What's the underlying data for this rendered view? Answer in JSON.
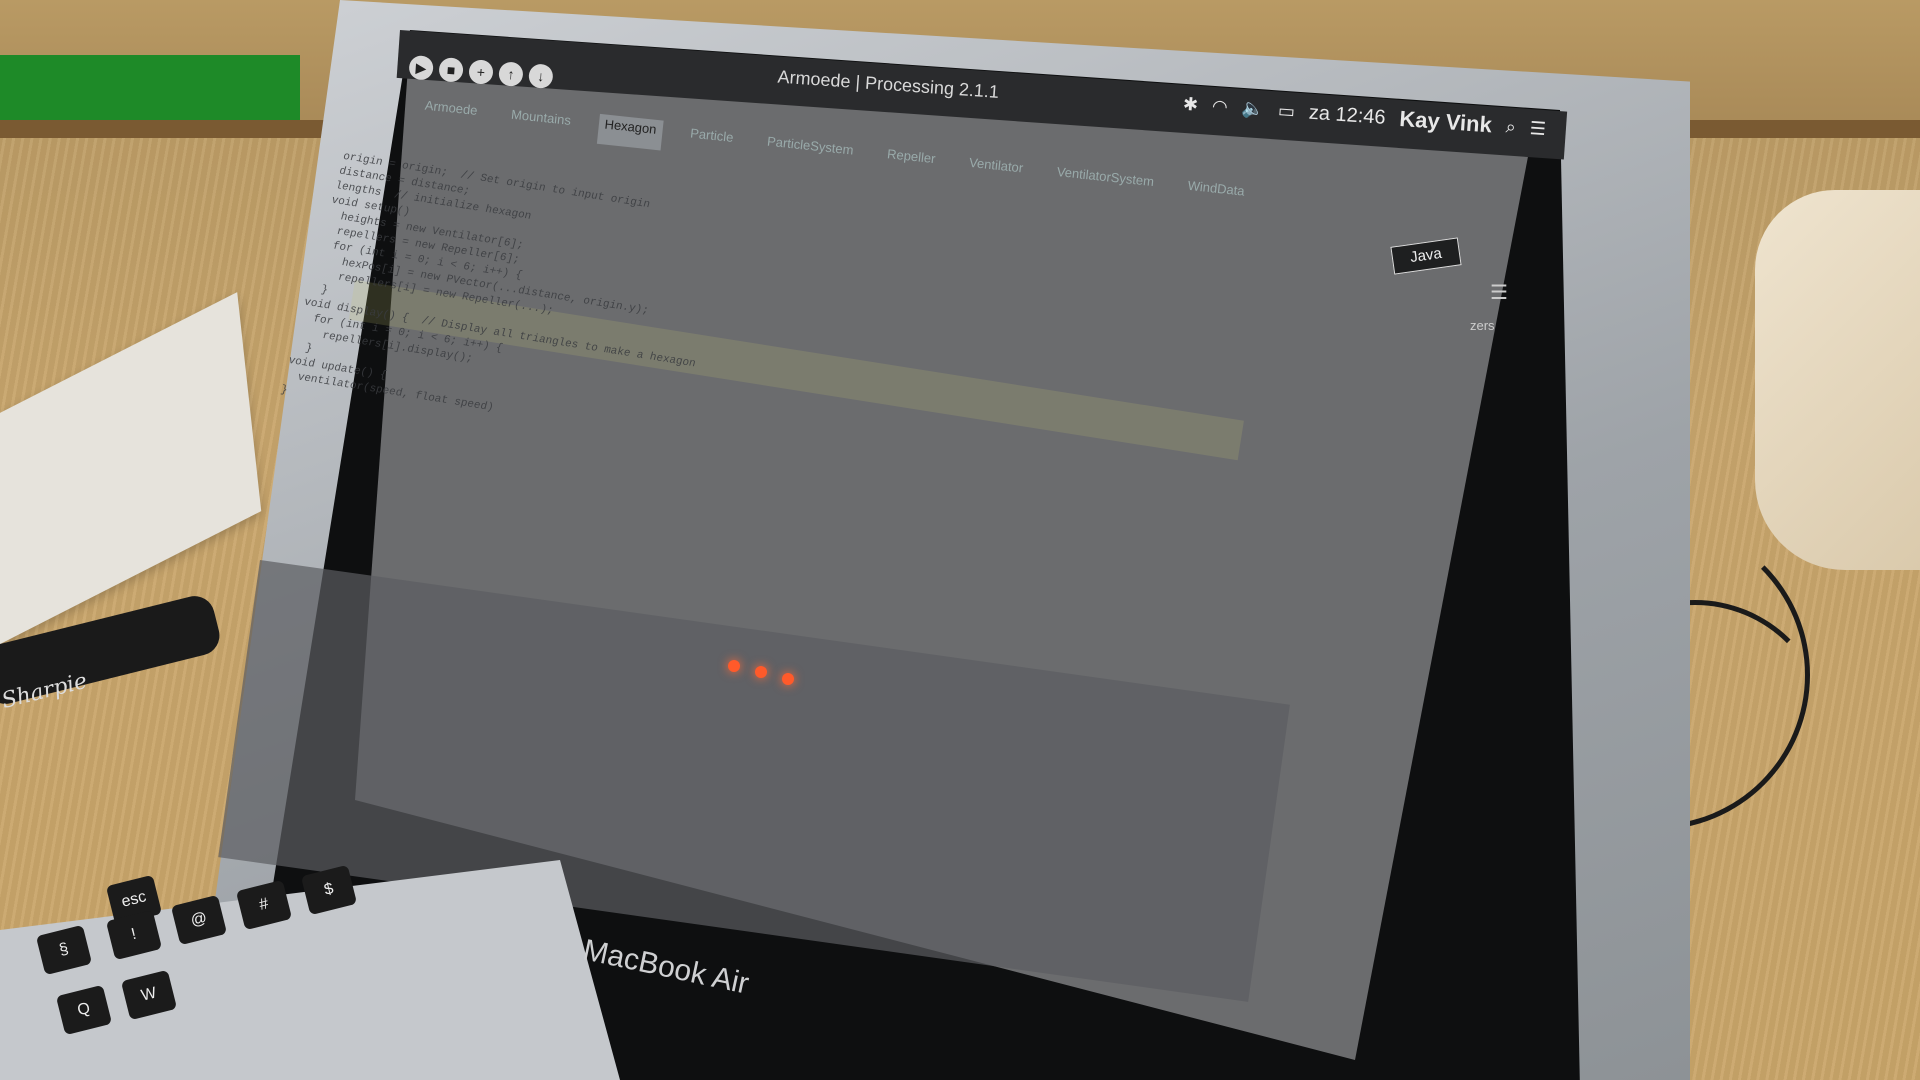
{
  "menubar": {
    "window_title": "Armoede | Processing 2.1.1",
    "clock": "za 12:46",
    "user": "Kay Vink",
    "status_icons": [
      "wifi-icon",
      "volume-icon",
      "battery-icon",
      "bluetooth-icon"
    ]
  },
  "toolbar": {
    "buttons": [
      "run-icon",
      "stop-icon",
      "new-icon",
      "open-icon",
      "save-icon",
      "export-icon"
    ]
  },
  "tabs": [
    "Armoede",
    "Mountains",
    "Hexagon",
    "Particle",
    "ParticleSystem",
    "Repeller",
    "Ventilator",
    "VentilatorSystem",
    "WindData"
  ],
  "mode_selector": "Java",
  "right_edge_label": "zers",
  "editor_lines": [
    "origin = origin;  // Set origin to input origin",
    "distance = distance;",
    "lengths  // initialize hexagon",
    "",
    "void setup()",
    "",
    "  heights = new Ventilator[6];",
    "  repellers = new Repeller[6];",
    "  for (int i = 0; i < 6; i++) {",
    "    hexPos[i] = new PVector(...distance, origin.y);",
    "    repellers[i] = new Repeller(...);",
    "  }",
    "",
    "void display() {  // Display all triangles to make a hexagon",
    "  for (int i = 0; i < 6; i++) {",
    "    repellers[i].display();",
    "  }",
    "",
    "void update() {",
    "  ventilator(speed, float speed)",
    "}"
  ],
  "keyboard": {
    "brand": "MacBook Air",
    "keys": [
      "esc",
      "§",
      "!",
      "@",
      "#",
      "$",
      "Q",
      "W"
    ]
  },
  "marker_label": "Sharpie"
}
